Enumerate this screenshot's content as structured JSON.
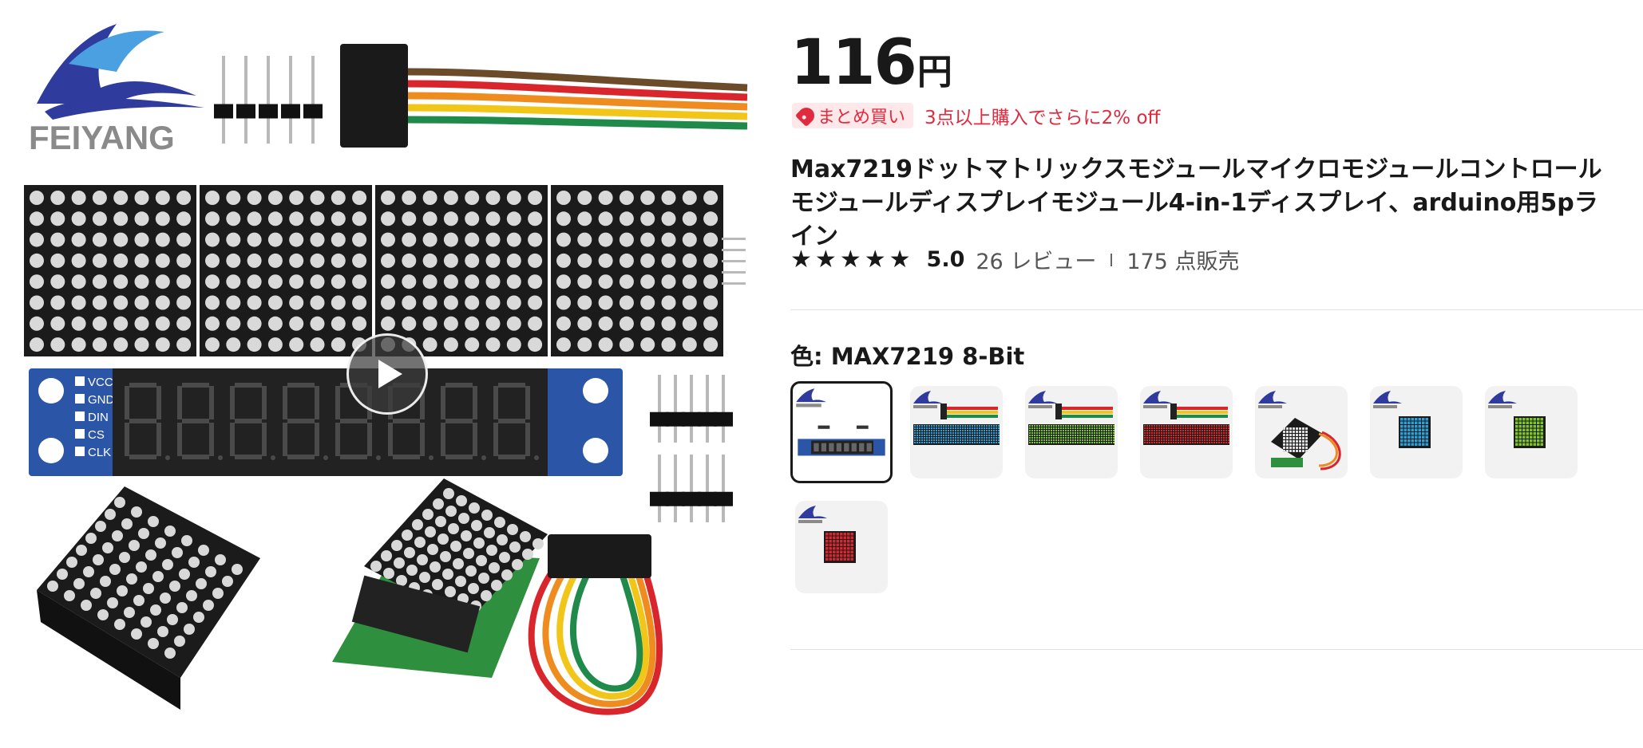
{
  "product": {
    "brand_logo_text": "FEIYANG",
    "board_pin_labels": [
      "VCC",
      "GND",
      "DIN",
      "CS",
      "CLK"
    ],
    "price_value": "116",
    "price_unit": "円",
    "bulk_badge_label": "まとめ買い",
    "bulk_offer_text": "3点以上購入でさらに2% off",
    "title": "Max7219ドットマトリックスモジュールマイクロモジュールコントロールモジュールディスプレイモジュール4-in-1ディスプレイ、arduino用5pライン",
    "rating_value": "5.0",
    "review_count_text": "26 レビュー",
    "sold_count_text": "175 点販売",
    "star_count": 5,
    "color_label": "色: MAX7219 8-Bit"
  },
  "variants": [
    {
      "kind": "8bit",
      "selected": true
    },
    {
      "kind": "strip",
      "led": "#2a9fd8"
    },
    {
      "kind": "strip",
      "led": "#7cc62a"
    },
    {
      "kind": "strip",
      "led": "#d8262c"
    },
    {
      "kind": "kit",
      "led": "#eeeeee"
    },
    {
      "kind": "single",
      "led": "#2a9fd8"
    },
    {
      "kind": "single",
      "led": "#7cc62a"
    },
    {
      "kind": "single",
      "led": "#d8262c"
    }
  ],
  "colors": {
    "price_text": "#191919",
    "promo_red": "#e02b3f",
    "promo_bg": "#ffe8ea",
    "logo_blue": "#2f3c9e",
    "pcb_blue": "#2b56a8",
    "matrix_body": "#1b1b1b"
  },
  "icons": {
    "star": "star-icon",
    "tag": "tag-icon",
    "play": "play-icon"
  }
}
